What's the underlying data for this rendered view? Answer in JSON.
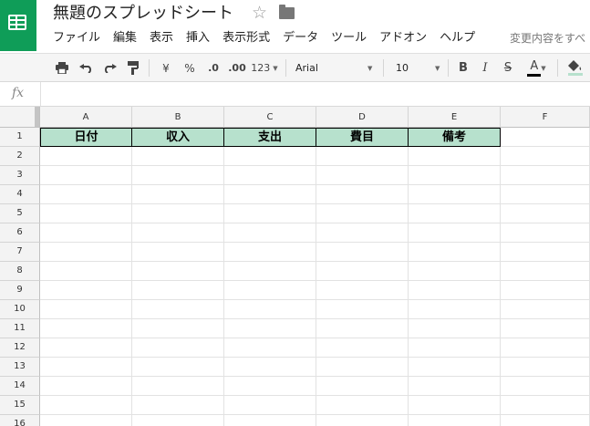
{
  "app": {
    "title": "無題のスプレッドシート",
    "save_status": "変更内容をすべ"
  },
  "menu": [
    "ファイル",
    "編集",
    "表示",
    "挿入",
    "表示形式",
    "データ",
    "ツール",
    "アドオン",
    "ヘルプ"
  ],
  "toolbar": {
    "currency": "¥",
    "percent": "%",
    "decimal_decrease": ".0",
    "decimal_increase": ".00",
    "more_formats": "123",
    "font_family": "Arial",
    "font_size": "10",
    "bold": "B",
    "italic": "I",
    "strikethrough": "S",
    "text_color": "A",
    "text_color_value": "#000000",
    "fill_color_value": "#b7e1cd"
  },
  "formula_bar": {
    "icon": "fx",
    "value": ""
  },
  "sheet": {
    "columns": [
      "A",
      "B",
      "C",
      "D",
      "E",
      "F"
    ],
    "rows": [
      "1",
      "2",
      "3",
      "4",
      "5",
      "6",
      "7",
      "8",
      "9",
      "10",
      "11",
      "12",
      "13",
      "14",
      "15",
      "16"
    ],
    "header_cells": [
      "日付",
      "収入",
      "支出",
      "費目",
      "備考"
    ],
    "header_fill": "#b7e1cd"
  }
}
